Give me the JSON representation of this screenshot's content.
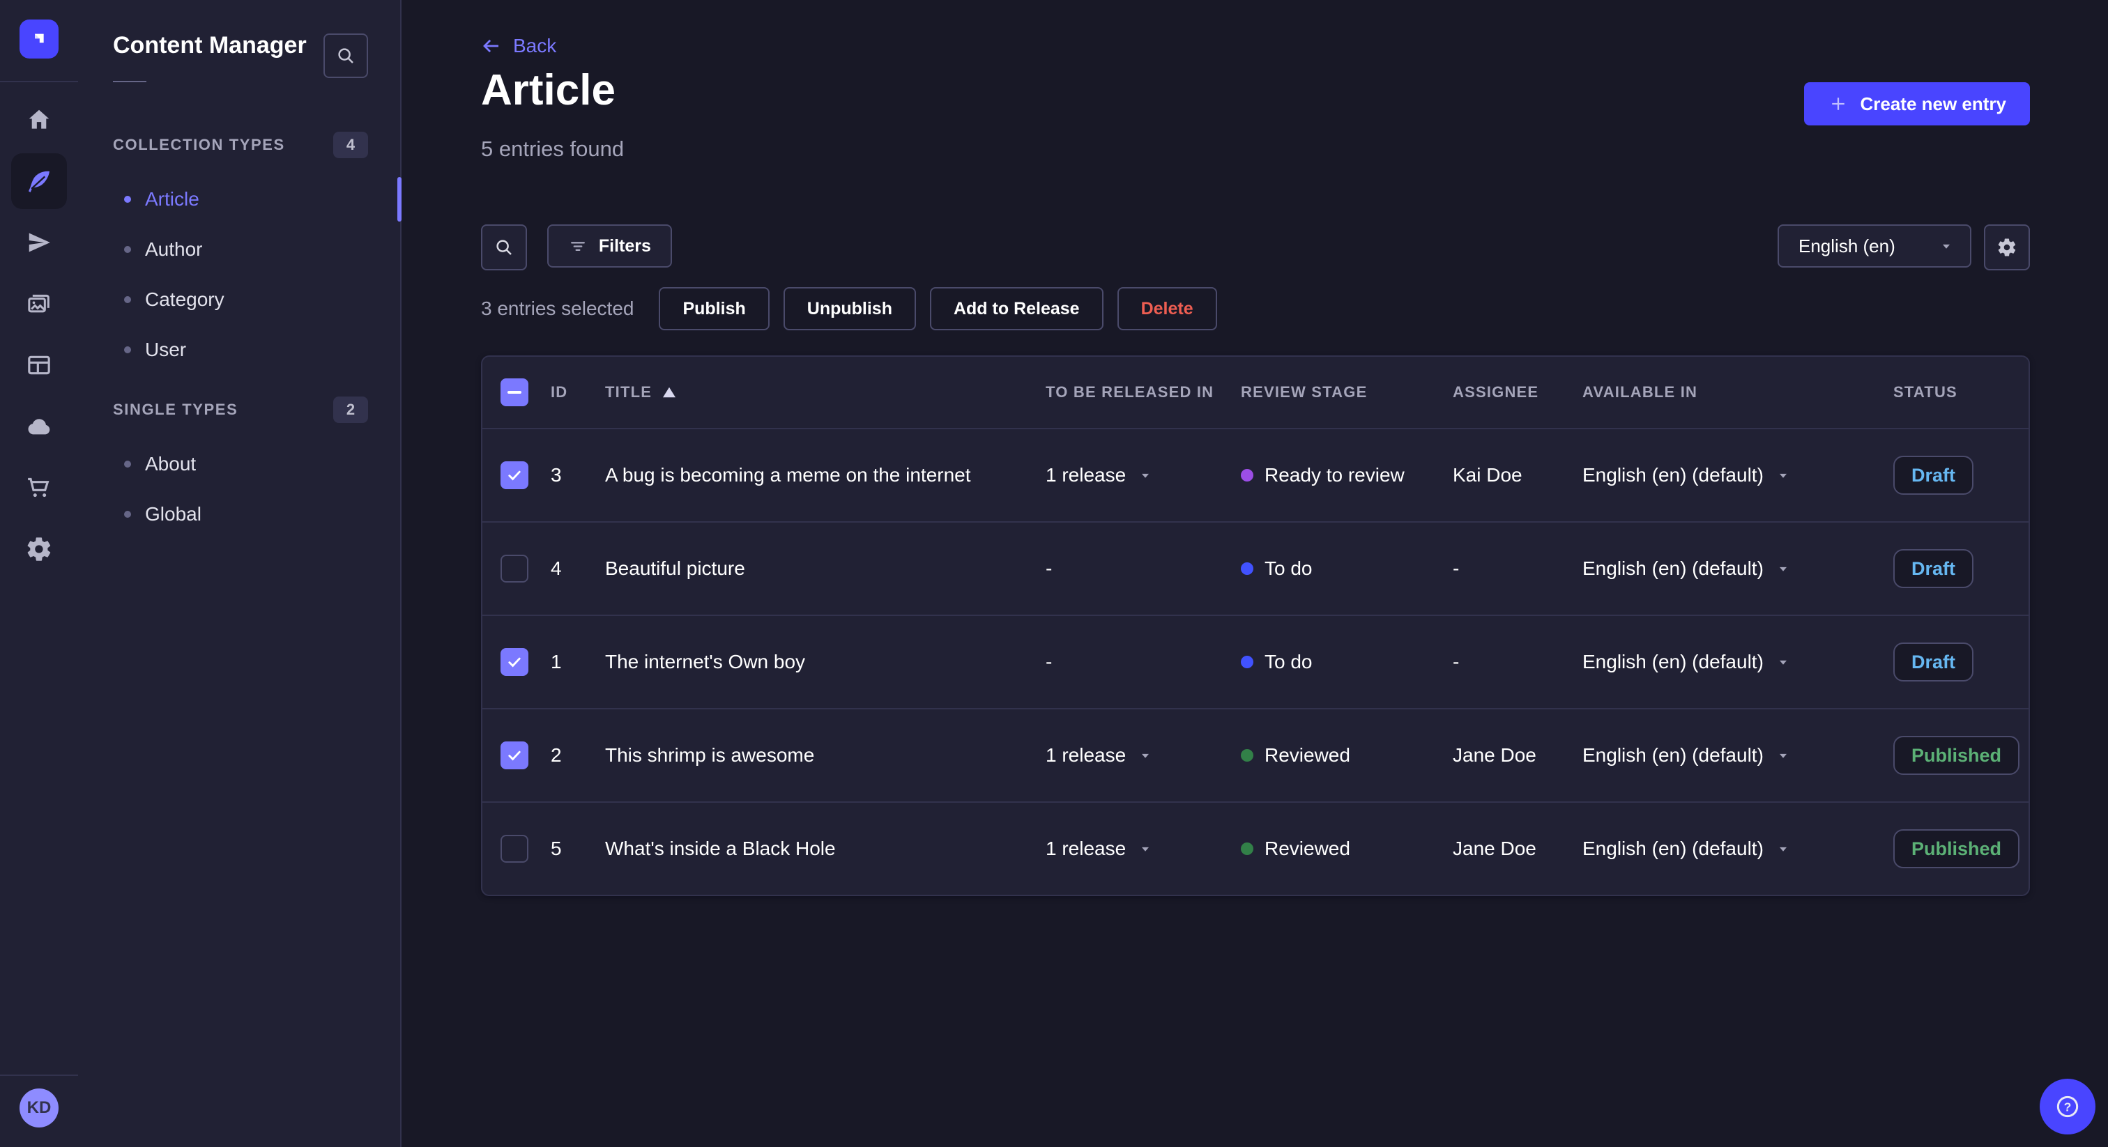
{
  "app": {
    "accent": "#4945ff",
    "accent_light": "#7b79ff",
    "danger": "#ee5e52"
  },
  "nav_rail": {
    "logo_icon": "strapi-logo",
    "items": [
      {
        "icon": "home-icon",
        "active": false
      },
      {
        "icon": "content-manager-feather-icon",
        "active": true
      },
      {
        "icon": "releases-paper-plane-icon",
        "active": false
      },
      {
        "icon": "media-library-icon",
        "active": false
      },
      {
        "icon": "content-type-builder-icon",
        "active": false
      },
      {
        "icon": "deploy-cloud-icon",
        "active": false
      },
      {
        "icon": "marketplace-cart-icon",
        "active": false
      },
      {
        "icon": "settings-gear-icon",
        "active": false
      }
    ],
    "avatar_initials": "KD"
  },
  "sidebar": {
    "title": "Content Manager",
    "search_icon": "search-icon",
    "sections": [
      {
        "label": "COLLECTION TYPES",
        "count": "4",
        "items": [
          {
            "label": "Article",
            "active": true
          },
          {
            "label": "Author",
            "active": false
          },
          {
            "label": "Category",
            "active": false
          },
          {
            "label": "User",
            "active": false
          }
        ]
      },
      {
        "label": "SINGLE TYPES",
        "count": "2",
        "items": [
          {
            "label": "About",
            "active": false
          },
          {
            "label": "Global",
            "active": false
          }
        ]
      }
    ]
  },
  "header": {
    "back_label": "Back",
    "title": "Article",
    "subtitle": "5 entries found",
    "create_button_label": "Create new entry"
  },
  "toolbar": {
    "filters_label": "Filters",
    "locale_value": "English (en)"
  },
  "selection": {
    "summary": "3 entries selected",
    "publish": "Publish",
    "unpublish": "Unpublish",
    "add_to_release": "Add to Release",
    "delete": "Delete"
  },
  "table": {
    "header_checkbox": "indeterminate",
    "sort": {
      "column": "TITLE",
      "direction": "asc"
    },
    "headers": {
      "id": "ID",
      "title": "TITLE",
      "released": "TO BE RELEASED IN",
      "review": "REVIEW STAGE",
      "assignee": "ASSIGNEE",
      "available": "AVAILABLE IN",
      "status": "STATUS"
    },
    "stage_colors": {
      "To do": "#4152ff",
      "Ready to review": "#9c4ee6",
      "Reviewed": "#328048"
    },
    "status_colors": {
      "Draft": "#66b7f1",
      "Published": "#5cb176"
    },
    "rows": [
      {
        "checked": true,
        "id": "3",
        "title": "A bug is becoming a meme on the internet",
        "released": "1 release",
        "review": "Ready to review",
        "assignee": "Kai Doe",
        "available": "English (en) (default)",
        "status": "Draft"
      },
      {
        "checked": false,
        "id": "4",
        "title": "Beautiful picture",
        "released": "-",
        "review": "To do",
        "assignee": "-",
        "available": "English (en) (default)",
        "status": "Draft"
      },
      {
        "checked": true,
        "id": "1",
        "title": "The internet's Own boy",
        "released": "-",
        "review": "To do",
        "assignee": "-",
        "available": "English (en) (default)",
        "status": "Draft"
      },
      {
        "checked": true,
        "id": "2",
        "title": "This shrimp is awesome",
        "released": "1 release",
        "review": "Reviewed",
        "assignee": "Jane Doe",
        "available": "English (en) (default)",
        "status": "Published"
      },
      {
        "checked": false,
        "id": "5",
        "title": "What's inside a Black Hole",
        "released": "1 release",
        "review": "Reviewed",
        "assignee": "Jane Doe",
        "available": "English (en) (default)",
        "status": "Published"
      }
    ]
  },
  "help": {
    "icon": "help-question-icon"
  }
}
